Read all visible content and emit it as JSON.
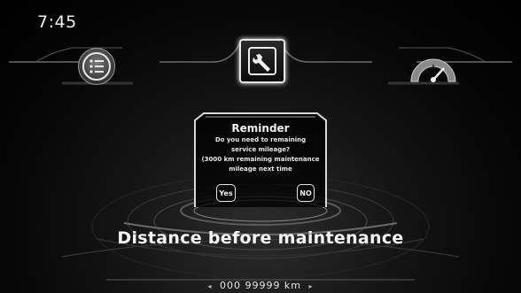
{
  "status": {
    "time": "7:45"
  },
  "top_menu": [
    {
      "name": "menu",
      "icon": "list-icon",
      "selected": false
    },
    {
      "name": "maintenance",
      "icon": "wrench-icon",
      "selected": true
    },
    {
      "name": "gauge",
      "icon": "speedometer-icon",
      "selected": false
    }
  ],
  "dialog": {
    "title": "Reminder",
    "line1": "Do you need to remaining",
    "line2": "service mileage?",
    "line3": "(3000 km remaining maintenance",
    "line4": "mileage next time",
    "yes_label": "Yes",
    "no_label": "NO"
  },
  "main": {
    "heading_part1": "Distance ",
    "heading_part2": "before maintenance",
    "mileage_value": "000 99999 km",
    "left_arrow": "◂",
    "right_arrow": "▸"
  },
  "colors": {
    "background": "#000000",
    "text": "#f2f2f2",
    "accent": "#e6e6e6"
  }
}
